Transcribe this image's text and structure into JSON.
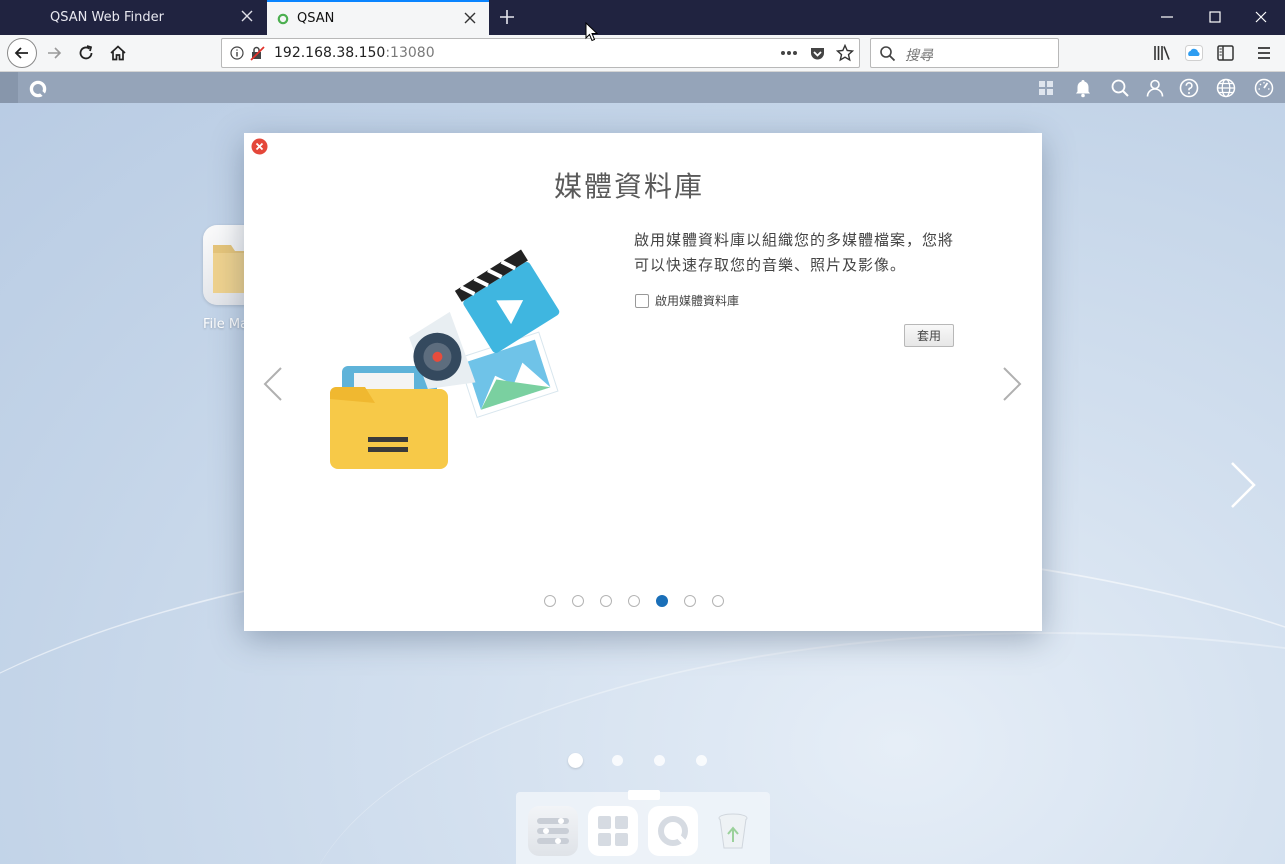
{
  "browser": {
    "tabs": [
      {
        "title": "QSAN Web Finder",
        "active": false
      },
      {
        "title": "QSAN",
        "active": true
      }
    ],
    "url": {
      "host": "192.168.38.150",
      "port": ":13080"
    },
    "search_placeholder": "搜尋"
  },
  "desktop": {
    "apps": [
      {
        "label": "File Ma"
      }
    ],
    "page_count": 4,
    "active_page": 1,
    "dock_items": [
      "control-panel",
      "app-center",
      "qsan-app",
      "recycle-bin"
    ]
  },
  "modal": {
    "title": "媒體資料庫",
    "description": "啟用媒體資料庫以組織您的多媒體檔案，您將可以快速存取您的音樂、照片及影像。",
    "checkbox_label": "啟用媒體資料庫",
    "checkbox_checked": false,
    "apply_label": "套用",
    "slide_count": 7,
    "active_slide": 5
  },
  "colors": {
    "titlebar": "#202340",
    "topbar": "#95a4b9",
    "accent": "#1a6fb8",
    "close_red": "#e4473a"
  }
}
